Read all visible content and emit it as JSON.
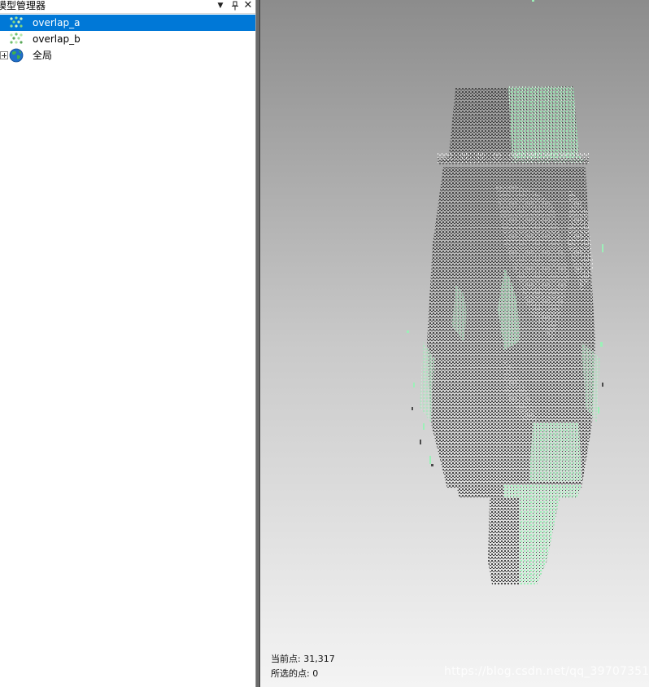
{
  "panel": {
    "title": "模型管理器",
    "buttons": {
      "dropdown": "▼",
      "pin": "ᛘ",
      "close": "✕"
    },
    "tree": [
      {
        "label": "overlap_a",
        "icon": "point-cloud-icon",
        "selected": true
      },
      {
        "label": "overlap_b",
        "icon": "point-cloud-icon",
        "selected": false
      },
      {
        "label": "全局",
        "icon": "globe-icon",
        "selected": false,
        "expandable": true
      }
    ]
  },
  "viewport": {
    "status": {
      "current_points": "当前点: 31,317",
      "selected_points": "所选的点: 0"
    },
    "watermark": "https://blog.csdn.net/qq_39707351",
    "colors": {
      "background_top": "#8c8c8c",
      "background_bottom": "#f4f4f4",
      "cloud_a": "#4a4a4a",
      "cloud_b": "#9cf0b8",
      "highlight": "#ffffff"
    }
  },
  "colors": {
    "selection": "#0078d7",
    "splitter": "#6b6b6b"
  }
}
